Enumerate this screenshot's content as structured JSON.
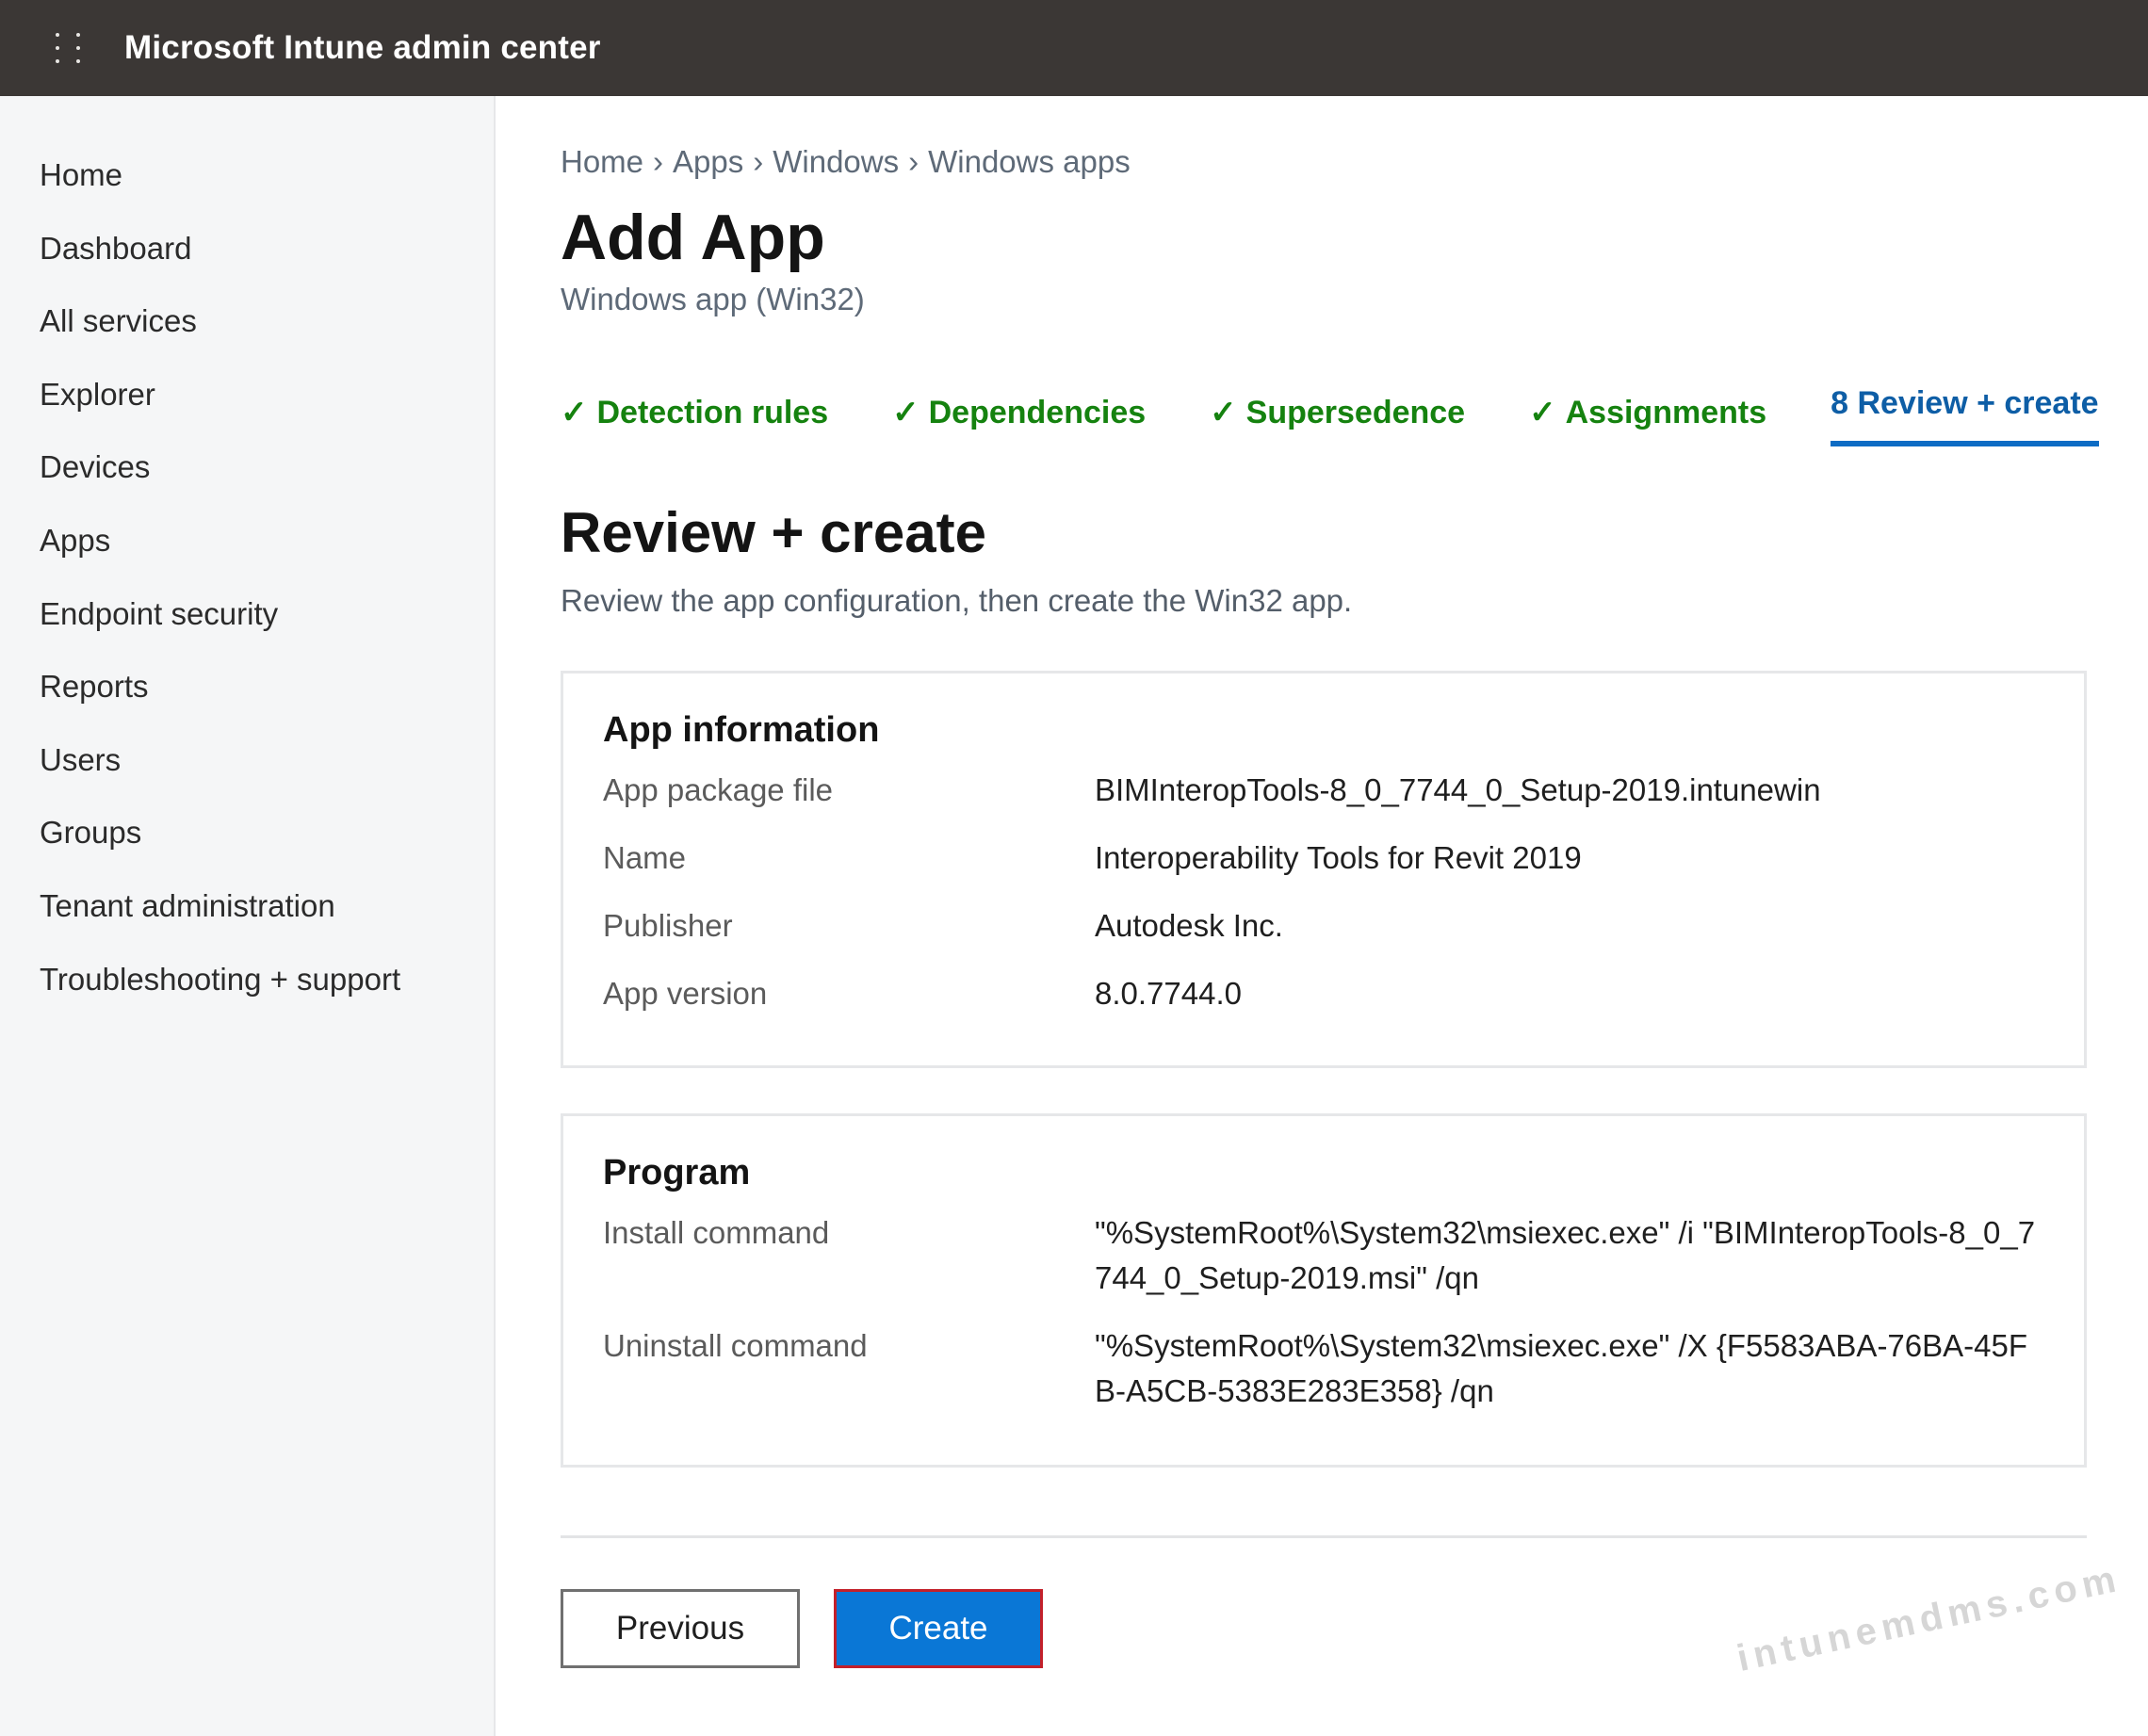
{
  "header": {
    "app_title": "Microsoft Intune admin center"
  },
  "sidebar": {
    "items": [
      {
        "label": "Home"
      },
      {
        "label": "Dashboard"
      },
      {
        "label": "All services"
      },
      {
        "label": "Explorer"
      },
      {
        "label": "Devices"
      },
      {
        "label": "Apps"
      },
      {
        "label": "Endpoint security"
      },
      {
        "label": "Reports"
      },
      {
        "label": "Users"
      },
      {
        "label": "Groups"
      },
      {
        "label": "Tenant administration"
      },
      {
        "label": "Troubleshooting + support"
      }
    ]
  },
  "breadcrumb": [
    "Home",
    "Apps",
    "Windows",
    "Windows apps"
  ],
  "breadcrumb_separator": "›",
  "page": {
    "title": "Add App",
    "subtitle": "Windows app (Win32)"
  },
  "steps": [
    {
      "label": "Detection rules",
      "status": "done"
    },
    {
      "label": "Dependencies",
      "status": "done"
    },
    {
      "label": "Supersedence",
      "status": "done"
    },
    {
      "label": "Assignments",
      "status": "done"
    },
    {
      "label": "8 Review + create",
      "status": "active"
    }
  ],
  "step_check": "✓",
  "review": {
    "title": "Review + create",
    "description": "Review the app configuration, then create the Win32 app."
  },
  "app_information": {
    "title": "App information",
    "rows": [
      {
        "label": "App package file",
        "value": "BIMInteropTools-8_0_7744_0_Setup-2019.intunewin"
      },
      {
        "label": "Name",
        "value": "Interoperability Tools for Revit 2019"
      },
      {
        "label": "Publisher",
        "value": "Autodesk Inc."
      },
      {
        "label": "App version",
        "value": "8.0.7744.0"
      }
    ]
  },
  "program": {
    "title": "Program",
    "rows": [
      {
        "label": "Install command",
        "value": "\"%SystemRoot%\\System32\\msiexec.exe\" /i \"BIMInteropTools-8_0_7744_0_Setup-2019.msi\" /qn"
      },
      {
        "label": "Uninstall command",
        "value": "\"%SystemRoot%\\System32\\msiexec.exe\" /X {F5583ABA-76BA-45FB-A5CB-5383E283E358} /qn"
      }
    ]
  },
  "buttons": {
    "previous": "Previous",
    "create": "Create"
  },
  "watermark": "intunemdms.com",
  "colors": {
    "topbar": "#3b3735",
    "done_step": "#15820f",
    "active_step": "#0e5ea6",
    "primary_button": "#0a77d6",
    "create_outline": "#c3202a"
  }
}
